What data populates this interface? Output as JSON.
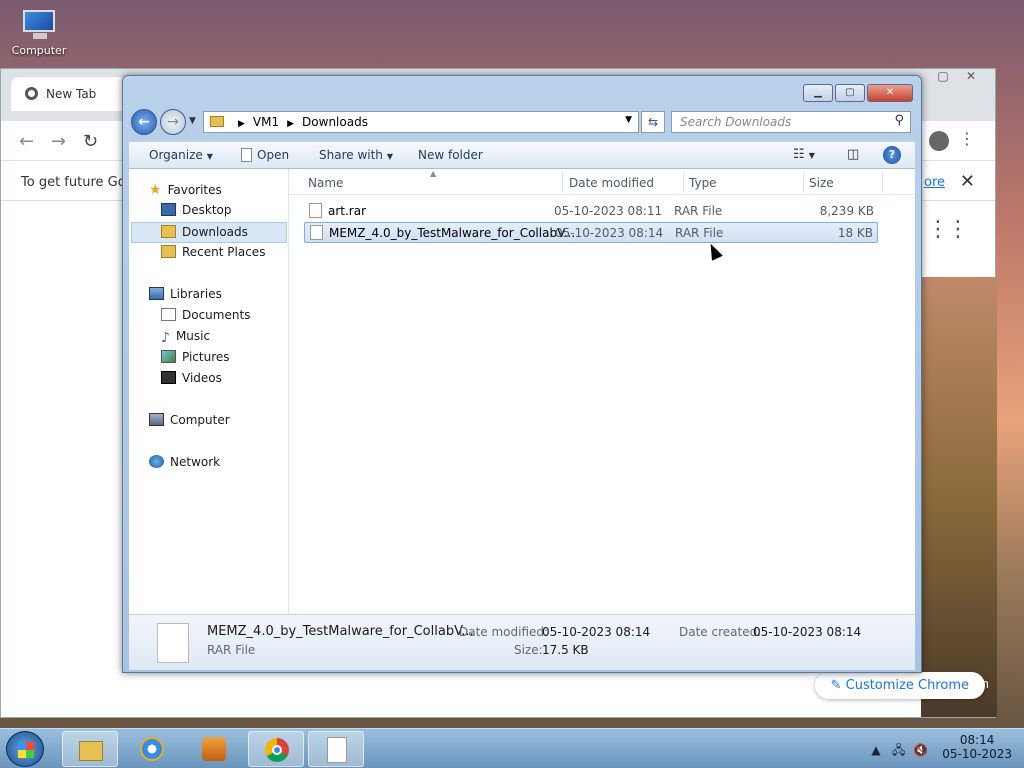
{
  "desktop": {
    "computer_label": "Computer"
  },
  "chrome": {
    "tab_title": "New Tab",
    "infobar_text": "To get future Goo",
    "infobar_link": "ore",
    "customize_label": "Customize Chrome",
    "signin_partial": "in"
  },
  "explorer": {
    "breadcrumb": [
      "VM1",
      "Downloads"
    ],
    "search_placeholder": "Search Downloads",
    "toolbar": {
      "organize": "Organize",
      "open": "Open",
      "share_with": "Share with",
      "new_folder": "New folder"
    },
    "nav": {
      "favorites": "Favorites",
      "desktop": "Desktop",
      "downloads": "Downloads",
      "recent_places": "Recent Places",
      "libraries": "Libraries",
      "documents": "Documents",
      "music": "Music",
      "pictures": "Pictures",
      "videos": "Videos",
      "computer": "Computer",
      "network": "Network"
    },
    "columns": {
      "name": "Name",
      "date": "Date modified",
      "type": "Type",
      "size": "Size"
    },
    "files": [
      {
        "name": "art.rar",
        "date": "05-10-2023 08:11",
        "type": "RAR File",
        "size": "8,239 KB"
      },
      {
        "name": "MEMZ_4.0_by_TestMalware_for_CollabV...",
        "date": "05-10-2023 08:14",
        "type": "RAR File",
        "size": "18 KB"
      }
    ],
    "details": {
      "name": "MEMZ_4.0_by_TestMalware_for_CollabV...",
      "type": "RAR File",
      "date_modified_label": "Date modified:",
      "date_modified": "05-10-2023 08:14",
      "date_created_label": "Date created:",
      "date_created": "05-10-2023 08:14",
      "size_label": "Size:",
      "size": "17.5 KB"
    }
  },
  "taskbar": {
    "time": "08:14",
    "date": "05-10-2023"
  }
}
